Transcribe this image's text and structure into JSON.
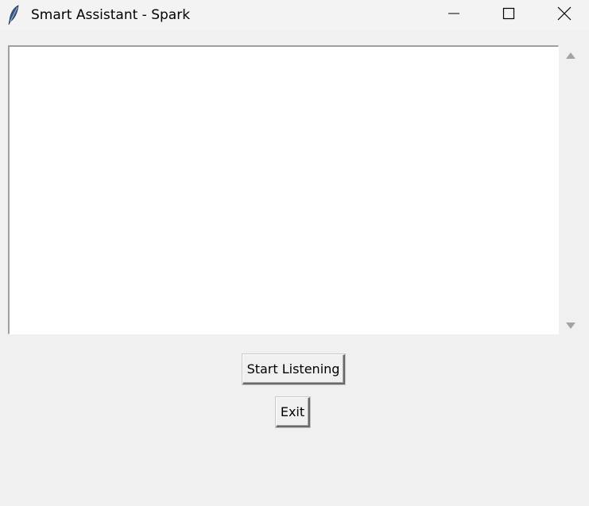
{
  "window": {
    "title": "Smart Assistant - Spark",
    "icon": "feather-icon",
    "controls": [
      "minimize-icon",
      "maximize-icon",
      "close-icon"
    ]
  },
  "output_text": {
    "value": ""
  },
  "buttons": {
    "start_label": "Start Listening",
    "exit_label": "Exit"
  },
  "colors": {
    "window_bg": "#f0f0f0",
    "textbox_bg": "#ffffff",
    "icon_blue": "#2f4f7f"
  }
}
